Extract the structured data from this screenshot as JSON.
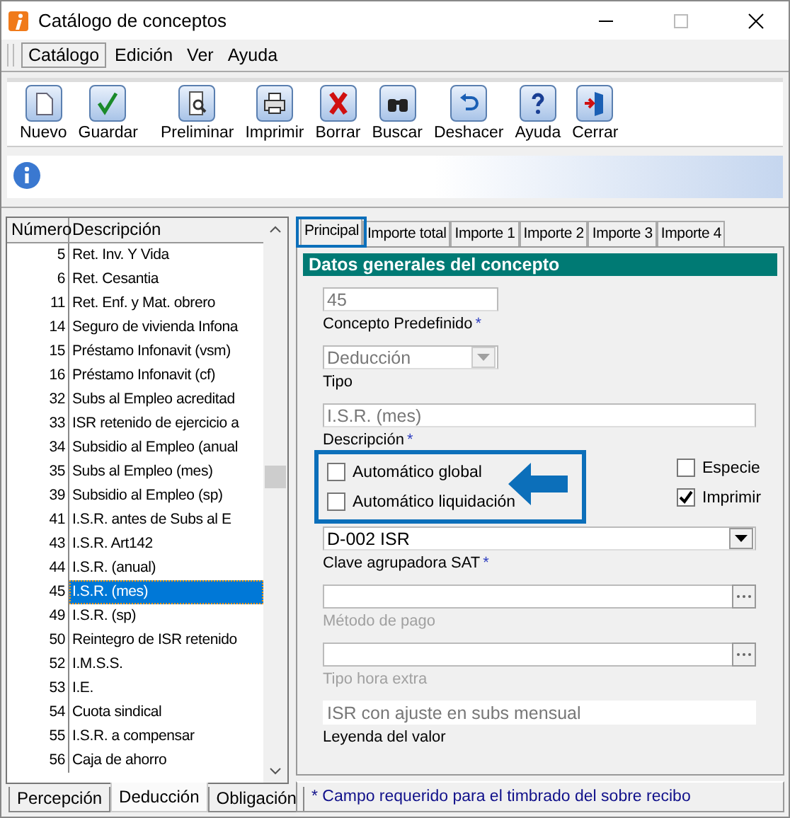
{
  "window": {
    "title": "Catálogo de conceptos"
  },
  "menu": [
    {
      "label": "Catálogo",
      "selected": true
    },
    {
      "label": "Edición",
      "selected": false
    },
    {
      "label": "Ver",
      "selected": false
    },
    {
      "label": "Ayuda",
      "selected": false
    }
  ],
  "toolbar": [
    "Nuevo",
    "Guardar",
    "Preliminar",
    "Imprimir",
    "Borrar",
    "Buscar",
    "Deshacer",
    "Ayuda",
    "Cerrar"
  ],
  "list": {
    "columns": [
      "Número",
      "Descripción"
    ],
    "rows": [
      {
        "number": "5",
        "description": "Ret. Inv. Y Vida",
        "selected": false
      },
      {
        "number": "6",
        "description": "Ret. Cesantia",
        "selected": false
      },
      {
        "number": "11",
        "description": "Ret. Enf. y Mat. obrero",
        "selected": false
      },
      {
        "number": "14",
        "description": "Seguro de vivienda Infona",
        "selected": false
      },
      {
        "number": "15",
        "description": "Préstamo Infonavit (vsm)",
        "selected": false
      },
      {
        "number": "16",
        "description": "Préstamo Infonavit (cf)",
        "selected": false
      },
      {
        "number": "32",
        "description": "Subs al Empleo acreditad",
        "selected": false
      },
      {
        "number": "33",
        "description": "ISR retenido de ejercicio a",
        "selected": false
      },
      {
        "number": "34",
        "description": "Subsidio al Empleo (anual",
        "selected": false
      },
      {
        "number": "35",
        "description": "Subs al Empleo (mes)",
        "selected": false
      },
      {
        "number": "39",
        "description": "Subsidio al Empleo (sp)",
        "selected": false
      },
      {
        "number": "41",
        "description": "I.S.R. antes de Subs al E",
        "selected": false
      },
      {
        "number": "43",
        "description": "I.S.R. Art142",
        "selected": false
      },
      {
        "number": "44",
        "description": "I.S.R. (anual)",
        "selected": false
      },
      {
        "number": "45",
        "description": "I.S.R. (mes)",
        "selected": true
      },
      {
        "number": "49",
        "description": "I.S.R. (sp)",
        "selected": false
      },
      {
        "number": "50",
        "description": "Reintegro de ISR retenido",
        "selected": false
      },
      {
        "number": "52",
        "description": "I.M.S.S.",
        "selected": false
      },
      {
        "number": "53",
        "description": "I.E.",
        "selected": false
      },
      {
        "number": "54",
        "description": "Cuota sindical",
        "selected": false
      },
      {
        "number": "55",
        "description": "I.S.R. a compensar",
        "selected": false
      },
      {
        "number": "56",
        "description": "Caja de ahorro",
        "selected": false
      }
    ]
  },
  "bottom_tabs": [
    {
      "label": "Percepción",
      "selected": false
    },
    {
      "label": "Deducción",
      "selected": true
    },
    {
      "label": "Obligación",
      "selected": false
    }
  ],
  "tabs": [
    {
      "label": "Principal",
      "selected": true
    },
    {
      "label": "Importe total",
      "selected": false
    },
    {
      "label": "Importe 1",
      "selected": false
    },
    {
      "label": "Importe 2",
      "selected": false
    },
    {
      "label": "Importe 3",
      "selected": false
    },
    {
      "label": "Importe 4",
      "selected": false
    }
  ],
  "section_title": "Datos generales del concepto",
  "fields_top": [
    {
      "kind": "text",
      "value": "45",
      "label": "Concepto Predefinido",
      "required_mark": "*",
      "readonly": true,
      "disabled": false
    },
    {
      "kind": "dropdown",
      "value": "Deducción",
      "label": "Tipo",
      "readonly": true,
      "disabled": false
    },
    {
      "kind": "text",
      "value": "I.S.R. (mes)",
      "label": "Descripción",
      "required_mark": "*",
      "readonly": true,
      "disabled": false
    }
  ],
  "checkboxes_left": [
    {
      "label": "Automático global",
      "checked": false
    },
    {
      "label": "Automático liquidación",
      "checked": false
    }
  ],
  "checkboxes_right": [
    {
      "label": "Especie",
      "checked": false
    },
    {
      "label": "Imprimir",
      "checked": true
    }
  ],
  "fields_bottom": [
    {
      "kind": "dropdown",
      "value": "D-002  ISR",
      "label": "Clave agrupadora SAT",
      "required_mark": "*",
      "disabled": false
    },
    {
      "kind": "ellipsis",
      "label": "Método de pago",
      "disabled": true
    },
    {
      "kind": "ellipsis",
      "label": "Tipo hora extra",
      "disabled": true
    },
    {
      "kind": "text",
      "value": "ISR con ajuste en subs mensual",
      "label": "Leyenda del valor",
      "readonly": true,
      "disabled": false
    }
  ],
  "status_bar": "* Campo requerido para el timbrado del sobre recibo"
}
